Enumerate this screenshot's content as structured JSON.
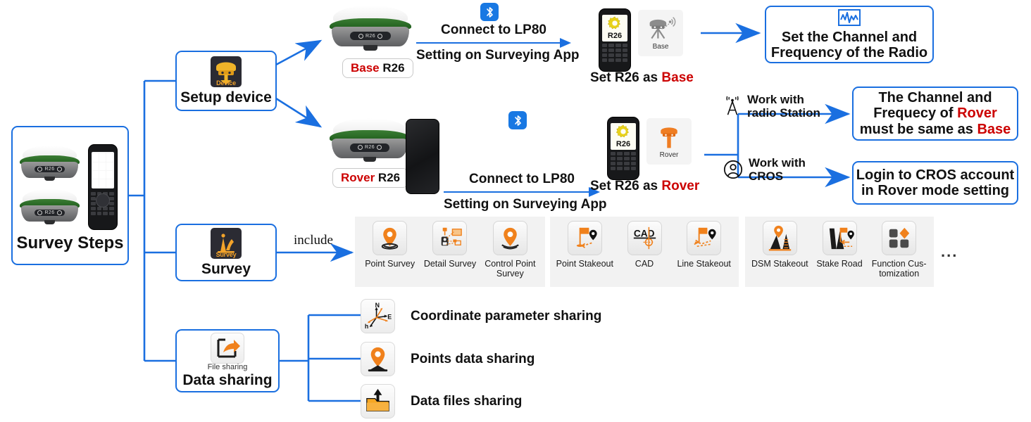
{
  "diagram": {
    "title": "Survey Steps workflow",
    "accent_blue": "#1a6fe0",
    "highlight_red": "#cc0000"
  },
  "root": {
    "label": "Survey Steps",
    "devices": [
      "R26 GNSS receiver",
      "R26 GNSS receiver",
      "LP80 handheld controller"
    ]
  },
  "branches": {
    "setup_device": {
      "label": "Setup device",
      "icon_label": "Device"
    },
    "survey": {
      "label": "Survey",
      "icon_label": "Survey",
      "connector_label": "include"
    },
    "data_sharing": {
      "label": "Data sharing",
      "icon_label": "File sharing"
    }
  },
  "base_row": {
    "device_tag_role": "Base",
    "device_tag_model": " R26",
    "arrow_top": "Connect to LP80",
    "arrow_bottom": "Setting on Surveying App",
    "bluetooth_icon": "bluetooth-icon",
    "controller_screen_label": "R26",
    "mode_tile_label": "Base",
    "caption_prefix": "Set R26 as ",
    "caption_role": "Base",
    "result_box": {
      "line1": "Set the Channel and",
      "line2": "Frequency of the Radio",
      "icon": "radio-waveform-icon"
    }
  },
  "rover_row": {
    "device_tag_role": "Rover",
    "device_tag_model": " R26",
    "arrow_top": "Connect to LP80",
    "arrow_bottom": "Setting on Surveying App",
    "bluetooth_icon": "bluetooth-icon",
    "controller_screen_label": "R26",
    "mode_tile_label": "Rover",
    "caption_prefix": "Set R26 as ",
    "caption_role": "Rover",
    "option_radio": {
      "icon": "radio-tower-icon",
      "line1": "Work with",
      "line2": "radio Station"
    },
    "option_cros": {
      "icon": "user-account-icon",
      "line1": "Work with",
      "line2": "CROS"
    },
    "result_radio": {
      "line1": "The Channel and",
      "line2_a": "Frequecy of ",
      "line2_b": "Rover",
      "line3_a": "must be same as ",
      "line3_b": "Base"
    },
    "result_cros": {
      "line1": "Login to CROS account",
      "line2": "in Rover mode setting"
    }
  },
  "survey_functions": {
    "groups": [
      {
        "items": [
          {
            "name": "Point Survey",
            "icon": "map-pin-survey-icon"
          },
          {
            "name": "Detail Survey",
            "icon": "detail-survey-icon"
          },
          {
            "name": "Control Point Survey",
            "icon": "control-point-survey-icon"
          }
        ]
      },
      {
        "items": [
          {
            "name": "Point Stakeout",
            "icon": "point-stakeout-icon"
          },
          {
            "name": "CAD",
            "icon": "cad-icon"
          },
          {
            "name": "Line Stakeout",
            "icon": "line-stakeout-icon"
          }
        ]
      },
      {
        "items": [
          {
            "name": "DSM Stakeout",
            "icon": "dsm-stakeout-icon"
          },
          {
            "name": "Stake Road",
            "icon": "stake-road-icon"
          },
          {
            "name": "Function Cus-tomization",
            "icon": "function-customization-icon"
          }
        ]
      }
    ],
    "more": "..."
  },
  "sharing_items": [
    {
      "label": "Coordinate parameter sharing",
      "icon": "coordinate-axes-icon"
    },
    {
      "label": "Points data sharing",
      "icon": "points-data-icon"
    },
    {
      "label": "Data files sharing",
      "icon": "upload-folder-icon"
    }
  ]
}
